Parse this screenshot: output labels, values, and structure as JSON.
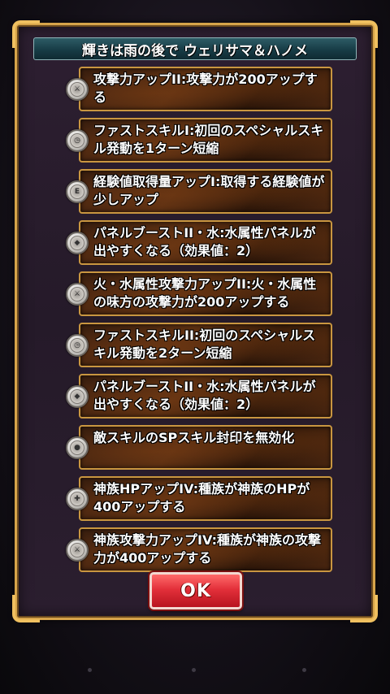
{
  "dialog": {
    "title": "輝きは雨の後で ウェリサマ＆ハノメ",
    "ok_label": "OK"
  },
  "skills": [
    {
      "text": "攻撃力アップII:攻撃力が200アップする",
      "icon": "sword-badge-icon"
    },
    {
      "text": "ファストスキルI:初回のスペシャルスキル発動を1ターン短縮",
      "icon": "clock-badge-icon"
    },
    {
      "text": "経験値取得量アップI:取得する経験値が少しアップ",
      "icon": "exp-badge-icon"
    },
    {
      "text": "パネルブーストII・水:水属性パネルが出やすくなる（効果値：2）",
      "icon": "panel-badge-icon"
    },
    {
      "text": "火・水属性攻撃力アップII:火・水属性の味方の攻撃力が200アップする",
      "icon": "attribute-attack-badge-icon"
    },
    {
      "text": "ファストスキルII:初回のスペシャルスキル発動を2ターン短縮",
      "icon": "clock-badge-icon"
    },
    {
      "text": "パネルブーストII・水:水属性パネルが出やすくなる（効果値：2）",
      "icon": "panel-badge-icon"
    },
    {
      "text": "敵スキルのSPスキル封印を無効化",
      "icon": "seal-guard-badge-icon"
    },
    {
      "text": "神族HPアップIV:種族が神族のHPが400アップする",
      "icon": "hp-badge-icon"
    },
    {
      "text": "神族攻撃力アップIV:種族が神族の攻撃力が400アップする",
      "icon": "sword-badge-icon"
    }
  ]
}
